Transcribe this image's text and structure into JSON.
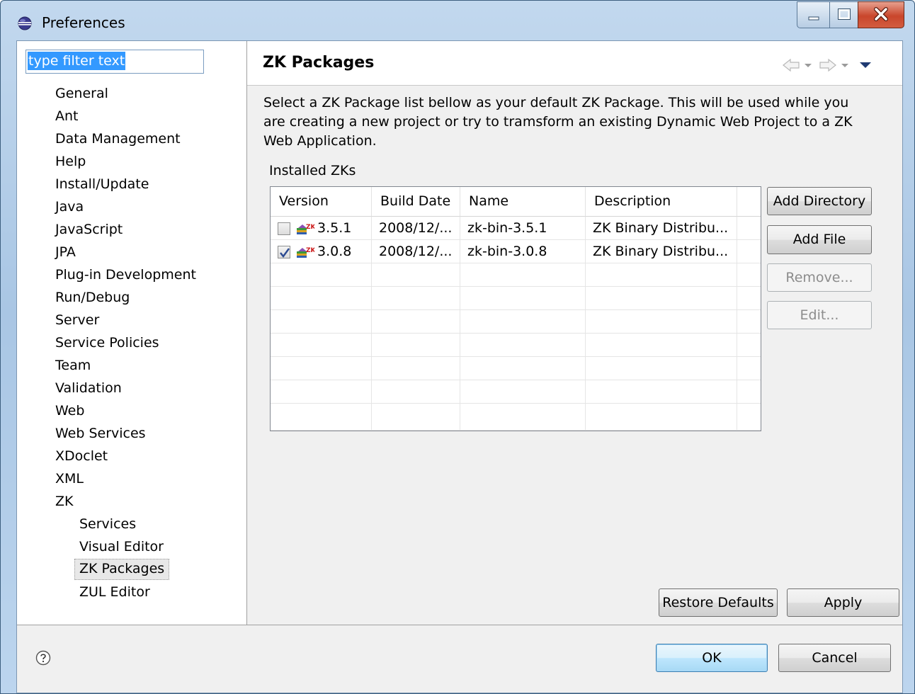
{
  "window": {
    "title": "Preferences",
    "icon": "eclipse-icon"
  },
  "filter": {
    "value": "type filter text"
  },
  "tree": {
    "items": [
      {
        "label": "General",
        "level": 0
      },
      {
        "label": "Ant",
        "level": 0
      },
      {
        "label": "Data Management",
        "level": 0
      },
      {
        "label": "Help",
        "level": 0
      },
      {
        "label": "Install/Update",
        "level": 0
      },
      {
        "label": "Java",
        "level": 0
      },
      {
        "label": "JavaScript",
        "level": 0
      },
      {
        "label": "JPA",
        "level": 0
      },
      {
        "label": "Plug-in Development",
        "level": 0
      },
      {
        "label": "Run/Debug",
        "level": 0
      },
      {
        "label": "Server",
        "level": 0
      },
      {
        "label": "Service Policies",
        "level": 0
      },
      {
        "label": "Team",
        "level": 0
      },
      {
        "label": "Validation",
        "level": 0
      },
      {
        "label": "Web",
        "level": 0
      },
      {
        "label": "Web Services",
        "level": 0
      },
      {
        "label": "XDoclet",
        "level": 0
      },
      {
        "label": "XML",
        "level": 0
      },
      {
        "label": "ZK",
        "level": 0
      },
      {
        "label": "Services",
        "level": 1
      },
      {
        "label": "Visual Editor",
        "level": 1
      },
      {
        "label": "ZK Packages",
        "level": 1,
        "selected": true
      },
      {
        "label": "ZUL Editor",
        "level": 1
      }
    ]
  },
  "page": {
    "title": "ZK Packages",
    "description": "Select a ZK Package list bellow as your default ZK Package. This will be used while you are creating a new project or try to tramsform an existing Dynamic Web Project to a ZK Web Application.",
    "installed_label": "Installed ZKs"
  },
  "table": {
    "columns": [
      "Version",
      "Build Date",
      "Name",
      "Description"
    ],
    "rows": [
      {
        "checked": false,
        "version": "3.5.1",
        "build_date": "2008/12/...",
        "name": "zk-bin-3.5.1",
        "description": "ZK Binary Distribu..."
      },
      {
        "checked": true,
        "version": "3.0.8",
        "build_date": "2008/12/...",
        "name": "zk-bin-3.0.8",
        "description": "ZK Binary Distribu..."
      }
    ]
  },
  "side_buttons": {
    "add_directory": "Add Directory",
    "add_file": "Add File",
    "remove": "Remove...",
    "edit": "Edit..."
  },
  "page_buttons": {
    "restore_defaults": "Restore Defaults",
    "apply": "Apply"
  },
  "dialog_buttons": {
    "ok": "OK",
    "cancel": "Cancel"
  },
  "colors": {
    "selection": "#3399ff",
    "title_bar": "#a9c6e4",
    "dialog_bg": "#f0f0f0"
  }
}
